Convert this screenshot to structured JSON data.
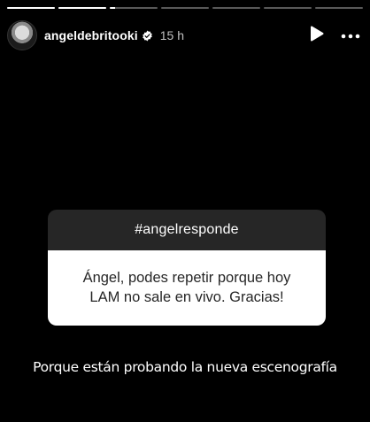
{
  "story": {
    "segments": [
      {
        "progress": 1
      },
      {
        "progress": 1
      },
      {
        "progress": 0.12
      },
      {
        "progress": 0
      },
      {
        "progress": 0
      },
      {
        "progress": 0
      },
      {
        "progress": 0
      }
    ],
    "active_segment": 3
  },
  "header": {
    "username": "angeldebritooki",
    "verified": true,
    "time": "15 h"
  },
  "icons": {
    "play": "play-icon",
    "more": "more-icon",
    "verified": "verified-badge-icon"
  },
  "sticker": {
    "hashtag": "#angelresponde",
    "question_line1": "Ángel, podes repetir porque hoy",
    "question_line2": "LAM no sale en vivo. Gracias!"
  },
  "answer_text": "Porque están probando la nueva escenografía"
}
